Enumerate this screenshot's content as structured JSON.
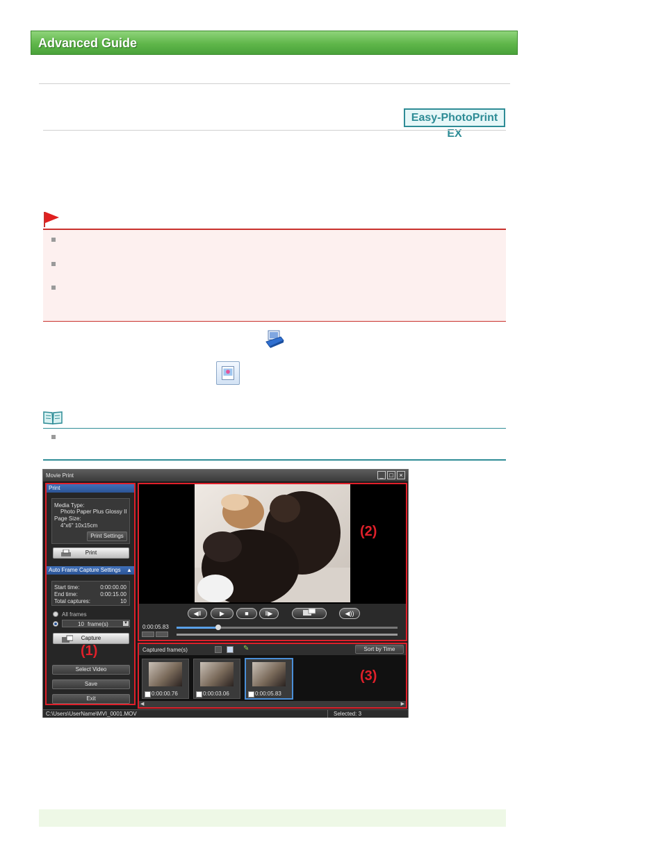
{
  "header": {
    "title": "Advanced Guide"
  },
  "badge": {
    "label": "Easy-PhotoPrint EX"
  },
  "app": {
    "title": "Movie Print",
    "window_controls": {
      "minimize": "_",
      "maximize": "□",
      "close": "×"
    },
    "left_panel": {
      "print_section": "Print",
      "media_type_label": "Media Type:",
      "media_type_value": "Photo Paper Plus Glossy II",
      "page_size_label": "Page Size:",
      "page_size_value": "4\"x6\" 10x15cm",
      "print_settings_button": "Print Settings",
      "print_button": "Print",
      "auto_capture_section": "Auto Frame Capture Settings",
      "start_time_label": "Start time:",
      "start_time_value": "0:00:00.00",
      "end_time_label": "End time:",
      "end_time_value": "0:00:15.00",
      "total_captures_label": "Total captures:",
      "total_captures_value": "10",
      "all_frames_label": "All frames",
      "frames_value": "10",
      "frames_unit": "frame(s)",
      "capture_button": "Capture",
      "select_video_button": "Select Video",
      "save_button": "Save",
      "exit_button": "Exit"
    },
    "video_panel": {
      "time_readout": "0:00:05.83",
      "playback_progress": 0.19
    },
    "frames_panel": {
      "title": "Captured frame(s)",
      "sort_button": "Sort by Time",
      "thumbnails": [
        {
          "time": "0:00:00.76",
          "checked": true
        },
        {
          "time": "0:00:03.06",
          "checked": true
        },
        {
          "time": "0:00:05.83",
          "checked": true
        }
      ]
    },
    "status_bar": {
      "path": "C:\\Users\\UserName\\MVI_0001.MOV",
      "selected": "Selected: 3"
    }
  },
  "callouts": {
    "one": "(1)",
    "two": "(2)",
    "three": "(3)"
  },
  "colors": {
    "banner": "#5fb64a",
    "accent": "#2e8c96",
    "important": "#c9302c",
    "callout": "#e0202a"
  }
}
